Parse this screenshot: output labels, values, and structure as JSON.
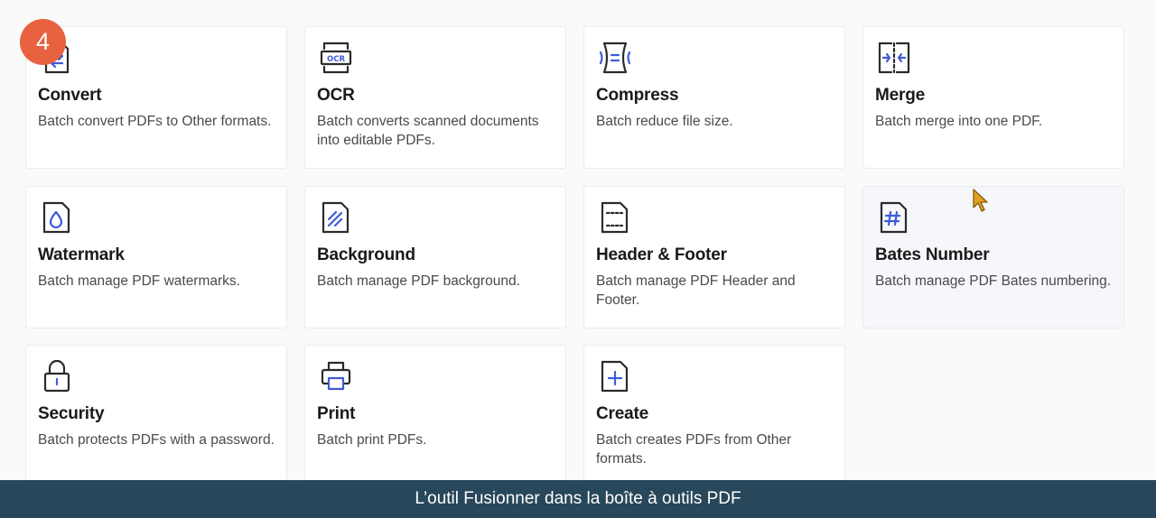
{
  "badge": {
    "number": "4",
    "color": "#e8623f"
  },
  "caption": {
    "text": "L’outil Fusionner dans la boîte à outils PDF"
  },
  "cards": [
    {
      "title": "Convert",
      "description": "Batch convert PDFs to Other formats.",
      "icon": "convert-icon"
    },
    {
      "title": "OCR",
      "description": "Batch converts scanned documents into editable PDFs.",
      "icon": "ocr-icon"
    },
    {
      "title": "Compress",
      "description": "Batch reduce file size.",
      "icon": "compress-icon"
    },
    {
      "title": "Merge",
      "description": "Batch merge into one PDF.",
      "icon": "merge-icon"
    },
    {
      "title": "Watermark",
      "description": "Batch manage PDF watermarks.",
      "icon": "watermark-icon"
    },
    {
      "title": "Background",
      "description": "Batch manage PDF background.",
      "icon": "background-icon"
    },
    {
      "title": "Header & Footer",
      "description": "Batch manage PDF Header and Footer.",
      "icon": "header-footer-icon"
    },
    {
      "title": "Bates Number",
      "description": "Batch manage PDF Bates numbering.",
      "icon": "bates-number-icon"
    },
    {
      "title": "Security",
      "description": "Batch protects PDFs with a password.",
      "icon": "lock-icon"
    },
    {
      "title": "Print",
      "description": "Batch print PDFs.",
      "icon": "printer-icon"
    },
    {
      "title": "Create",
      "description": "Batch creates PDFs from Other formats.",
      "icon": "create-pdf-icon"
    }
  ],
  "colors": {
    "icon_stroke": "#2b2b2b",
    "icon_accent": "#3d5bd9",
    "caption_bg": "#28475a",
    "cursor": "#e0a021"
  }
}
